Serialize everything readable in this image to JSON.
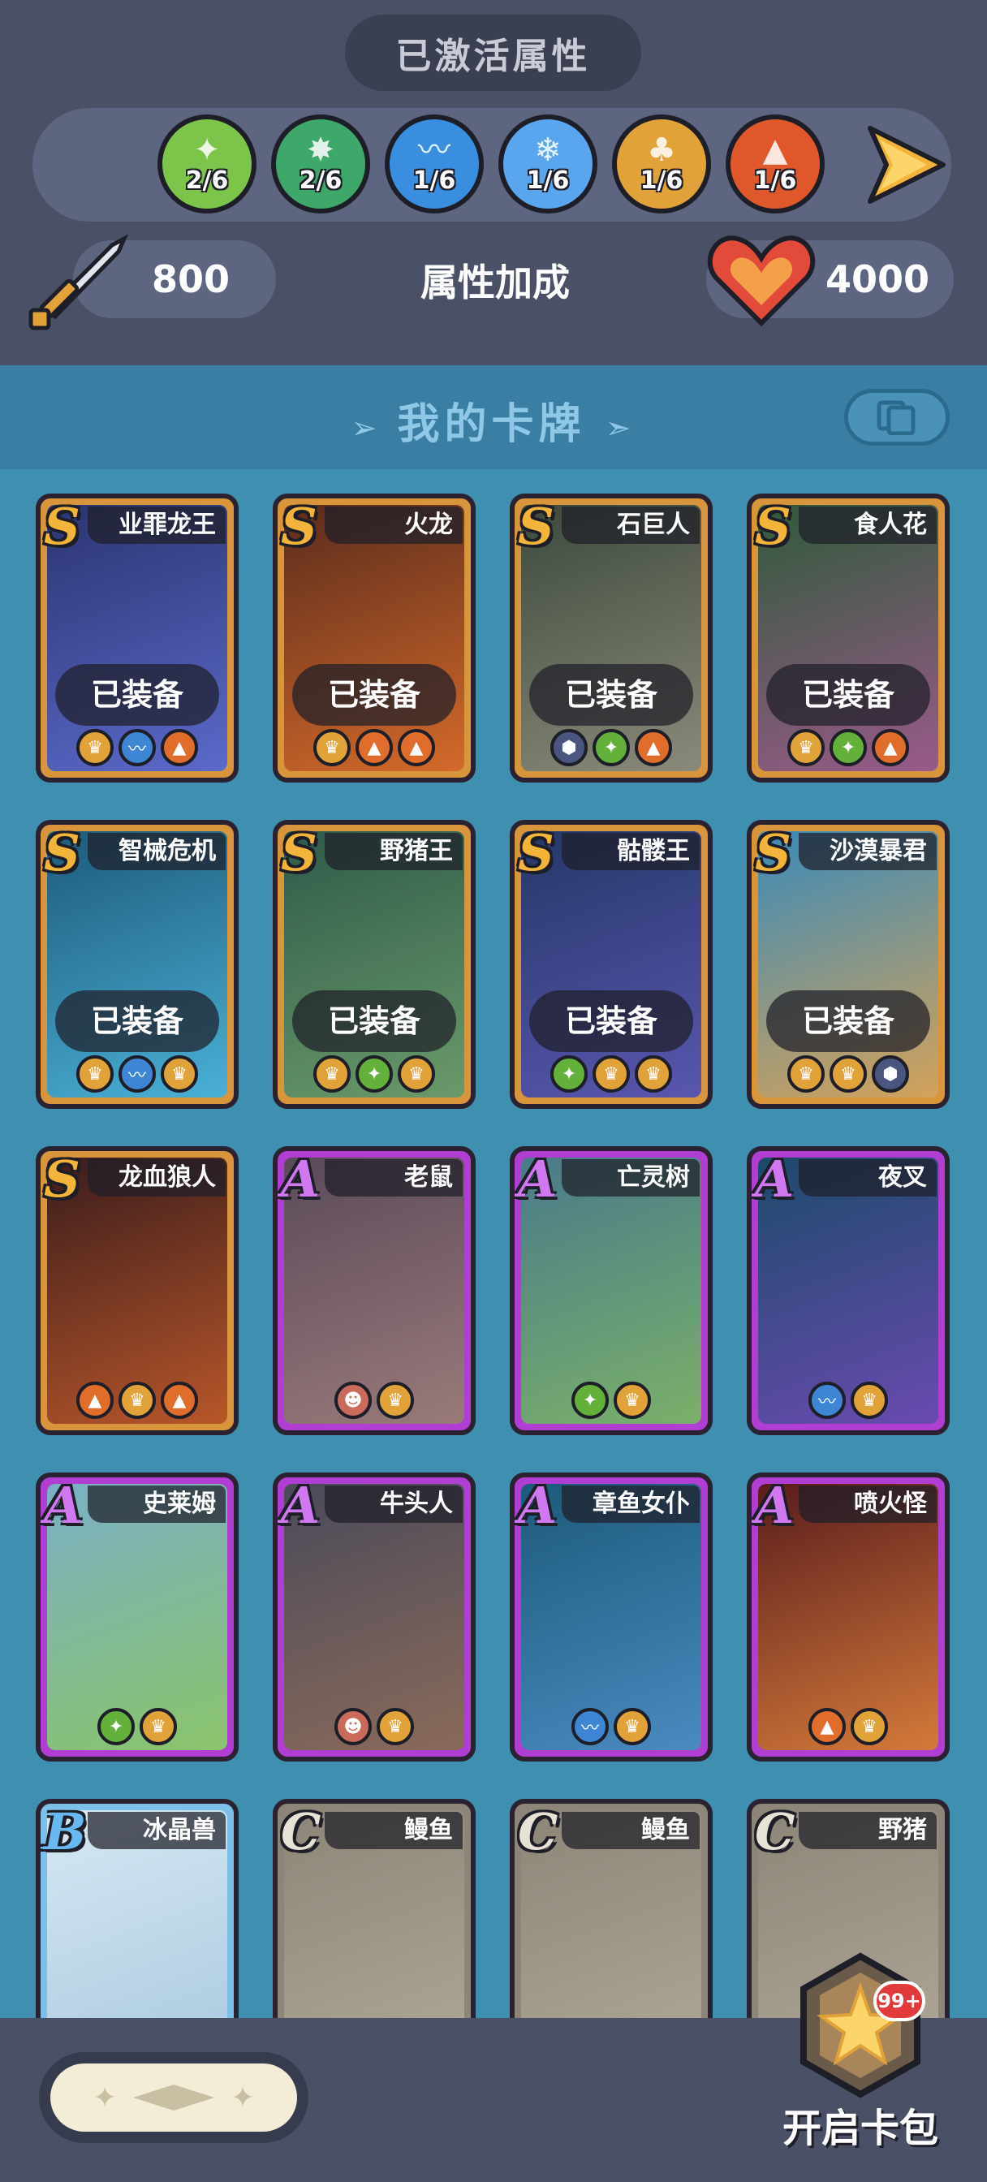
{
  "top": {
    "title": "已激活属性",
    "attributes": [
      {
        "count": "2/6",
        "icon": "grass-icon",
        "color": "#7cc44a",
        "glyph": "✦"
      },
      {
        "count": "2/6",
        "icon": "leaf-sprout-icon",
        "color": "#3ea86a",
        "glyph": "✸"
      },
      {
        "count": "1/6",
        "icon": "wave-icon",
        "color": "#3a8ee0",
        "glyph": "〰"
      },
      {
        "count": "1/6",
        "icon": "ice-crystal-icon",
        "color": "#5aa6ee",
        "glyph": "❄"
      },
      {
        "count": "1/6",
        "icon": "cactus-icon",
        "color": "#e2a23a",
        "glyph": "♣"
      },
      {
        "count": "1/6",
        "icon": "volcano-icon",
        "color": "#e0572b",
        "glyph": "▲"
      }
    ],
    "attack_value": "800",
    "bonus_label": "属性加成",
    "hp_value": "4000"
  },
  "cards_section": {
    "title": "我的卡牌"
  },
  "cards": [
    {
      "rank": "S",
      "name": "业罪龙王",
      "equipped": "已装备",
      "icons": [
        "gold",
        "water",
        "fire"
      ],
      "art": [
        "#2b3470",
        "#5b6acb"
      ]
    },
    {
      "rank": "S",
      "name": "火龙",
      "equipped": "已装备",
      "icons": [
        "gold",
        "fire",
        "fire"
      ],
      "art": [
        "#5a2b1c",
        "#d46a2a"
      ]
    },
    {
      "rank": "S",
      "name": "石巨人",
      "equipped": "已装备",
      "icons": [
        "dark",
        "nature",
        "fire"
      ],
      "art": [
        "#3c4a3c",
        "#8a8a7a"
      ]
    },
    {
      "rank": "S",
      "name": "食人花",
      "equipped": "已装备",
      "icons": [
        "gold",
        "nature",
        "fire"
      ],
      "art": [
        "#2f5a3a",
        "#9a5a8a"
      ]
    },
    {
      "rank": "S",
      "name": "智械危机",
      "equipped": "已装备",
      "icons": [
        "gold",
        "water",
        "gold"
      ],
      "art": [
        "#1d5a7a",
        "#4ab0d6"
      ]
    },
    {
      "rank": "S",
      "name": "野猪王",
      "equipped": "已装备",
      "icons": [
        "gold",
        "nature",
        "gold"
      ],
      "art": [
        "#2e5a4a",
        "#6a9a6a"
      ]
    },
    {
      "rank": "S",
      "name": "骷髅王",
      "equipped": "已装备",
      "icons": [
        "nature",
        "gold",
        "gold"
      ],
      "art": [
        "#243868",
        "#5a56b0"
      ]
    },
    {
      "rank": "S",
      "name": "沙漠暴君",
      "equipped": "已装备",
      "icons": [
        "gold",
        "gold",
        "dark"
      ],
      "art": [
        "#3a8ab8",
        "#d4a25a"
      ]
    },
    {
      "rank": "S",
      "name": "龙血狼人",
      "equipped": "",
      "icons": [
        "fire",
        "gold",
        "fire"
      ],
      "art": [
        "#3a1c1c",
        "#b8562a"
      ]
    },
    {
      "rank": "A",
      "name": "老鼠",
      "equipped": "",
      "icons": [
        "skin",
        "gold"
      ],
      "art": [
        "#5a4a5a",
        "#9a7a7a"
      ]
    },
    {
      "rank": "A",
      "name": "亡灵树",
      "equipped": "",
      "icons": [
        "nature",
        "gold"
      ],
      "art": [
        "#4a7a8a",
        "#7ab06a"
      ]
    },
    {
      "rank": "A",
      "name": "夜叉",
      "equipped": "",
      "icons": [
        "water",
        "gold"
      ],
      "art": [
        "#1c4a6a",
        "#6a4ab0"
      ]
    },
    {
      "rank": "A",
      "name": "史莱姆",
      "equipped": "",
      "icons": [
        "nature",
        "gold"
      ],
      "art": [
        "#7ab0c6",
        "#8ac46a"
      ]
    },
    {
      "rank": "A",
      "name": "牛头人",
      "equipped": "",
      "icons": [
        "skin",
        "gold"
      ],
      "art": [
        "#4a4a5a",
        "#8a6a5a"
      ]
    },
    {
      "rank": "A",
      "name": "章鱼女仆",
      "equipped": "",
      "icons": [
        "water",
        "gold"
      ],
      "art": [
        "#1c5a7a",
        "#4a8ac0"
      ]
    },
    {
      "rank": "A",
      "name": "喷火怪",
      "equipped": "",
      "icons": [
        "fire",
        "gold"
      ],
      "art": [
        "#5a1c1c",
        "#d47a3a"
      ]
    },
    {
      "rank": "B",
      "name": "冰晶兽",
      "equipped": "",
      "icons": [],
      "art": [
        "#d6e8f2",
        "#a8c8e0"
      ]
    },
    {
      "rank": "C",
      "name": "鳗鱼",
      "equipped": "",
      "icons": [],
      "art": [
        "#8d8577",
        "#b0a898"
      ]
    },
    {
      "rank": "C",
      "name": "鳗鱼",
      "equipped": "",
      "icons": [],
      "art": [
        "#8d8577",
        "#b0a898"
      ]
    },
    {
      "rank": "C",
      "name": "野猪",
      "equipped": "",
      "icons": [],
      "art": [
        "#8d8577",
        "#b0a898"
      ]
    }
  ],
  "bottom": {
    "pack_badge": "99+",
    "pack_label": "开启卡包"
  }
}
